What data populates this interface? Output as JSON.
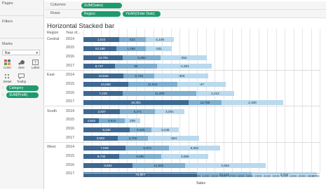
{
  "shelves": {
    "pages_label": "Pages",
    "columns_label": "Columns",
    "rows_label": "Rows",
    "columns_pill": "SUM(Sales)",
    "rows_pills": [
      "Region",
      "YEAR(Order Date)"
    ]
  },
  "left_panel": {
    "filters_label": "Filters",
    "marks_label": "Marks",
    "mark_type": "Bar",
    "mark_buttons": [
      {
        "label": "Color",
        "icon": "color-icon"
      },
      {
        "label": "Size",
        "icon": "size-icon"
      },
      {
        "label": "Label",
        "icon": "label-icon"
      },
      {
        "label": "Detail",
        "icon": "detail-icon"
      },
      {
        "label": "Tooltip",
        "icon": "tooltip-icon"
      }
    ],
    "mark_pills": [
      "Category",
      "SUM(Profit)"
    ]
  },
  "chart": {
    "title": "Horizontal Stacked bar",
    "header_region": "Region",
    "header_year": "Year of...",
    "axis_title": "Sales"
  },
  "chart_data": {
    "type": "bar",
    "orientation": "horizontal",
    "stacked": true,
    "title": "Horizontal Stacked bar",
    "xlabel": "Sales",
    "xlim": [
      0,
      270000
    ],
    "x_ticks": [
      "0K",
      "10K",
      "20K",
      "30K",
      "40K",
      "50K",
      "60K",
      "70K",
      "80K",
      "90K",
      "100K",
      "110K",
      "120K",
      "130K",
      "140K",
      "150K",
      "160K",
      "170K",
      "180K",
      "190K",
      "200K",
      "210K",
      "220K",
      "230K",
      "240K",
      "250K",
      "260K",
      "270K"
    ],
    "color_encoding": "SUM(Profit)",
    "palette": {
      "dark": "#3e6892",
      "medium": "#7eaecf",
      "light": "#b9d9ee"
    },
    "groups": [
      {
        "region": "Central",
        "rows": [
          {
            "year": "2014",
            "segments": [
              {
                "value": 41000,
                "label": "1,022",
                "shade": "dark"
              },
              {
                "value": 30000,
                "label": "622",
                "shade": "medium"
              },
              {
                "value": 32000,
                "label": "-1,105",
                "shade": "light"
              }
            ]
          },
          {
            "year": "2015",
            "segments": [
              {
                "value": 38000,
                "label": "10,168",
                "shade": "dark"
              },
              {
                "value": 33000,
                "label": "1,780",
                "shade": "medium"
              },
              {
                "value": 30000,
                "label": "-231",
                "shade": "light"
              }
            ]
          },
          {
            "year": "2016",
            "segments": [
              {
                "value": 45000,
                "label": "13,761",
                "shade": "dark"
              },
              {
                "value": 43000,
                "label": "6,392",
                "shade": "medium"
              },
              {
                "value": 53000,
                "label": "-254",
                "shade": "light"
              }
            ]
          },
          {
            "year": "2017",
            "segments": [
              {
                "value": 36000,
                "label": "8,747",
                "shade": "dark"
              },
              {
                "value": 48000,
                "label": "85",
                "shade": "medium"
              },
              {
                "value": 63000,
                "label": "-1,261",
                "shade": "light"
              }
            ]
          }
        ]
      },
      {
        "region": "East",
        "rows": [
          {
            "year": "2014",
            "segments": [
              {
                "value": 46000,
                "label": "10,834",
                "shade": "dark"
              },
              {
                "value": 35000,
                "label": "6,725",
                "shade": "medium"
              },
              {
                "value": 62000,
                "label": "-300",
                "shade": "light"
              }
            ]
          },
          {
            "year": "2015",
            "segments": [
              {
                "value": 51000,
                "label": "10,598",
                "shade": "dark"
              },
              {
                "value": 56000,
                "label": "11,041",
                "shade": "medium"
              },
              {
                "value": 56000,
                "label": "-47",
                "shade": "light"
              }
            ]
          },
          {
            "year": "2016",
            "segments": [
              {
                "value": 45000,
                "label": "7,229",
                "shade": "dark"
              },
              {
                "value": 84000,
                "label": "11,499",
                "shade": "medium"
              },
              {
                "value": 43000,
                "label": "1,413",
                "shade": "light"
              }
            ]
          },
          {
            "year": "2017",
            "segments": [
              {
                "value": 120000,
                "label": "19,301",
                "shade": "dark"
              },
              {
                "value": 38000,
                "label": "11,750",
                "shade": "medium"
              },
              {
                "value": 70000,
                "label": "2,180",
                "shade": "light"
              }
            ]
          }
        ]
      },
      {
        "region": "South",
        "rows": [
          {
            "year": "2014",
            "segments": [
              {
                "value": 42000,
                "label": "2,607",
                "shade": "dark"
              },
              {
                "value": 40000,
                "label": "5,271",
                "shade": "medium"
              },
              {
                "value": 33000,
                "label": "4,001",
                "shade": "light"
              }
            ]
          },
          {
            "year": "2015",
            "segments": [
              {
                "value": 18000,
                "label": "4,503",
                "shade": "dark"
              },
              {
                "value": 29000,
                "label": "3,610",
                "shade": "medium"
              },
              {
                "value": 18000,
                "label": "209",
                "shade": "light"
              }
            ]
          },
          {
            "year": "2016",
            "segments": [
              {
                "value": 53000,
                "label": "9,232",
                "shade": "dark"
              },
              {
                "value": 25000,
                "label": "5,325",
                "shade": "medium"
              },
              {
                "value": 31000,
                "label": "3,146",
                "shade": "light"
              }
            ]
          },
          {
            "year": "2017",
            "segments": [
              {
                "value": 39000,
                "label": "3,653",
                "shade": "dark"
              },
              {
                "value": 35000,
                "label": "5,780",
                "shade": "medium"
              },
              {
                "value": 58000,
                "label": "-584",
                "shade": "light"
              }
            ]
          }
        ]
      },
      {
        "region": "West",
        "rows": [
          {
            "year": "2014",
            "segments": [
              {
                "value": 48000,
                "label": "7,029",
                "shade": "dark"
              },
              {
                "value": 50000,
                "label": "9,974",
                "shade": "medium"
              },
              {
                "value": 58000,
                "label": "5,062",
                "shade": "light"
              }
            ]
          },
          {
            "year": "2015",
            "segments": [
              {
                "value": 41000,
                "label": "8,730",
                "shade": "dark"
              },
              {
                "value": 48000,
                "label": "8,660",
                "shade": "medium"
              },
              {
                "value": 54000,
                "label": "3,085",
                "shade": "light"
              }
            ]
          },
          {
            "year": "2016",
            "segments": [
              {
                "value": 56000,
                "label": "9,552",
                "shade": "dark"
              },
              {
                "value": 60000,
                "label": "11,845",
                "shade": "medium"
              },
              {
                "value": 92000,
                "label": "2,654",
                "shade": "light"
              }
            ]
          },
          {
            "year": "2017",
            "segments": [
              {
                "value": 130000,
                "label": "16,984",
                "shade": "dark"
              },
              {
                "value": 62000,
                "label": "22,121",
                "shade": "medium"
              },
              {
                "value": 75000,
                "label": "2,704",
                "shade": "light"
              }
            ]
          }
        ]
      }
    ]
  }
}
